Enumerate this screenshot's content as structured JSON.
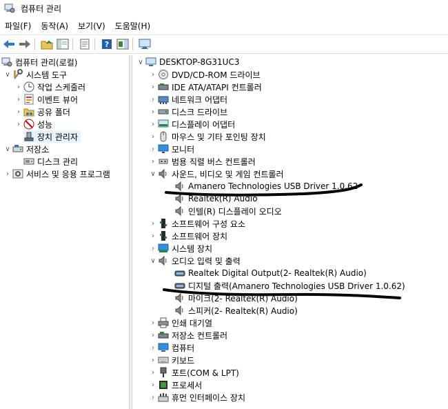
{
  "window": {
    "title": "컴퓨터 관리"
  },
  "menu": [
    "파일(F)",
    "동작(A)",
    "보기(V)",
    "도움말(H)"
  ],
  "left_tree": {
    "root": "컴퓨터 관리(로컬)",
    "system_tools": "시스템 도구",
    "task_scheduler": "작업 스케줄러",
    "event_viewer": "이벤트 뷰어",
    "shared_folders": "공유 폴더",
    "performance": "성능",
    "device_manager": "장치 관리자",
    "storage": "저장소",
    "disk_management": "디스크 관리",
    "services": "서비스 및 응용 프로그램"
  },
  "right_tree": {
    "computer": "DESKTOP-8G31UC3",
    "dvd": "DVD/CD-ROM 드라이브",
    "ide": "IDE ATA/ATAPI 컨트롤러",
    "network": "네트워크 어댑터",
    "disk_drive": "디스크 드라이브",
    "display": "디스플레이 어댑터",
    "mouse": "마우스 및 기타 포인팅 장치",
    "monitor": "모니터",
    "usb": "범용 직렬 버스 컨트롤러",
    "sound": "사운드, 비디오 및 게임 컨트롤러",
    "sound_children": [
      "Amanero Technologies USB Driver 1.0.62",
      "Realtek(R) Audio",
      "인텔(R) 디스플레이 오디오"
    ],
    "software_components": "소프트웨어 구성 요소",
    "software_devices": "소프트웨어 장치",
    "system_devices": "시스템 장치",
    "audio_io": "오디오 입력 및 출력",
    "audio_children": [
      "Realtek Digital Output(2- Realtek(R) Audio)",
      "디지털 출력(Amanero Technologies USB Driver 1.0.62)",
      "마이크(2- Realtek(R) Audio)",
      "스피커(2- Realtek(R) Audio)"
    ],
    "print_queue": "인쇄 대기열",
    "storage_controllers": "저장소 컨트롤러",
    "computer_cat": "컴퓨터",
    "keyboard": "키보드",
    "ports": "포트(COM & LPT)",
    "processor": "프로세서",
    "hid": "휴먼 인터페이스 장치"
  },
  "colors": {
    "selection": "#e5f3ff",
    "annotation": "#000000",
    "accent": "#1e6fd0"
  }
}
